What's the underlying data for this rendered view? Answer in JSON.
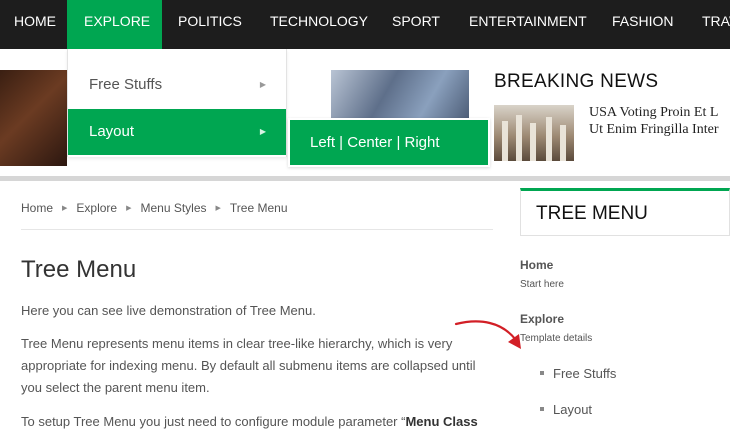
{
  "nav": {
    "items": [
      "HOME",
      "EXPLORE",
      "POLITICS",
      "TECHNOLOGY",
      "SPORT",
      "ENTERTAINMENT",
      "FASHION",
      "TRAV"
    ],
    "active_index": 1,
    "active_color": "#00a651"
  },
  "dropdown": {
    "items": [
      {
        "label": "Free Stuffs",
        "active": false
      },
      {
        "label": "Layout",
        "active": true
      }
    ],
    "submenu": {
      "label": "Left | Center | Right"
    }
  },
  "breaking": {
    "title": "BREAKING NEWS",
    "headline_line1": "USA Voting Proin Et L",
    "headline_line2": "Ut Enim Fringilla Inter"
  },
  "breadcrumb": [
    "Home",
    "Explore",
    "Menu Styles",
    "Tree Menu"
  ],
  "main": {
    "title": "Tree Menu",
    "para1": "Here you can see live demonstration of Tree Menu.",
    "para2_lines": [
      "Tree Menu represents menu items in clear tree-like hierarchy, which is very",
      "appropriate for indexing menu. By default all submenu items are collapsed until",
      "you select the parent menu item."
    ],
    "para3_start": "To setup Tree Menu you just need to configure module parameter “",
    "para3_bold": "Menu Class"
  },
  "tree_menu": {
    "title": "TREE MENU",
    "sections": [
      {
        "label": "Home",
        "sub": "Start here"
      },
      {
        "label": "Explore",
        "sub": "Template details"
      }
    ],
    "children": [
      "Free Stuffs",
      "Layout"
    ]
  },
  "icons": {
    "dropdown_caret": "caret-right-icon",
    "breadcrumb_separator": "triangle-right-icon",
    "annotation": "curved-red-arrow-icon"
  }
}
